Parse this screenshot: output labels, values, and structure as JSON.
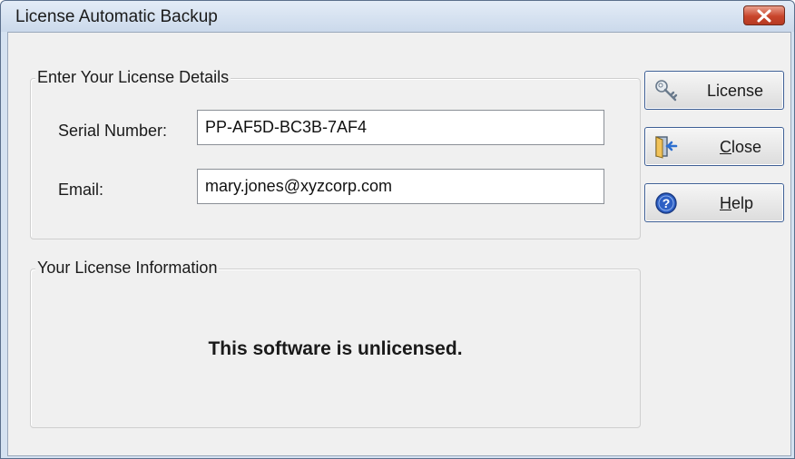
{
  "window": {
    "title": "License Automatic Backup",
    "close_label": "×"
  },
  "details_group": {
    "legend": "Enter Your License Details",
    "serial_label": "Serial Number:",
    "serial_value": "PP-AF5D-BC3B-7AF4",
    "email_label": "Email:",
    "email_value": "mary.jones@xyzcorp.com"
  },
  "info_group": {
    "legend": "Your License Information",
    "status": "This software is unlicensed."
  },
  "buttons": {
    "license": {
      "label": "License",
      "icon": "key-icon"
    },
    "close": {
      "mnemonic": "C",
      "rest": "lose",
      "icon": "exit-door-icon"
    },
    "help": {
      "mnemonic": "H",
      "rest": "elp",
      "icon": "help-icon"
    }
  },
  "colors": {
    "title_bar": "#cbd9eb",
    "close_button": "#c8452c",
    "button_border": "#3e5f95",
    "dialog_background": "#f0f0f0"
  }
}
